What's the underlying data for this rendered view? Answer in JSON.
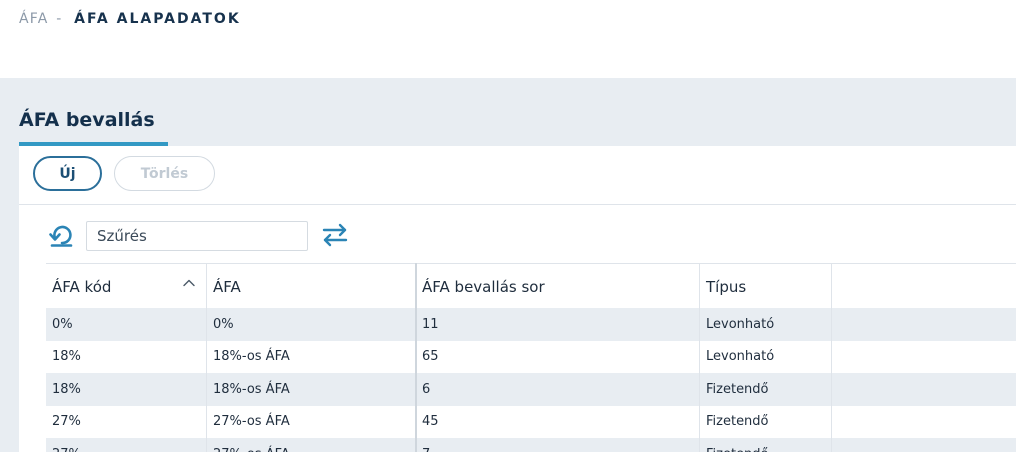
{
  "breadcrumb": {
    "parent": "ÁFA",
    "separator": "-",
    "current": "ÁFA ALAPADATOK"
  },
  "tab": {
    "title": "ÁFA bevallás"
  },
  "toolbar": {
    "new_label": "Új",
    "delete_label": "Törlés"
  },
  "filter": {
    "placeholder": "Szűrés",
    "refresh_icon": "refresh-icon",
    "swap_icon": "swap-arrows-icon"
  },
  "table": {
    "columns": [
      "ÁFA kód",
      "ÁFA",
      "ÁFA bevallás sor",
      "Típus"
    ],
    "sort_icon": "chevron-up-icon",
    "rows": [
      [
        "0%",
        "0%",
        "11",
        "Levonható"
      ],
      [
        "18%",
        "18%-os ÁFA",
        "65",
        "Levonható"
      ],
      [
        "18%",
        "18%-os ÁFA",
        "6",
        "Fizetendő"
      ],
      [
        "27%",
        "27%-os ÁFA",
        "45",
        "Fizetendő"
      ],
      [
        "27%",
        "27%-os ÁFA",
        "7",
        "Fizetendő"
      ]
    ]
  },
  "colors": {
    "accent": "#3399c4",
    "primary_button_border": "#2b6f9a",
    "background": "#e8edf2",
    "title": "#14304c"
  }
}
